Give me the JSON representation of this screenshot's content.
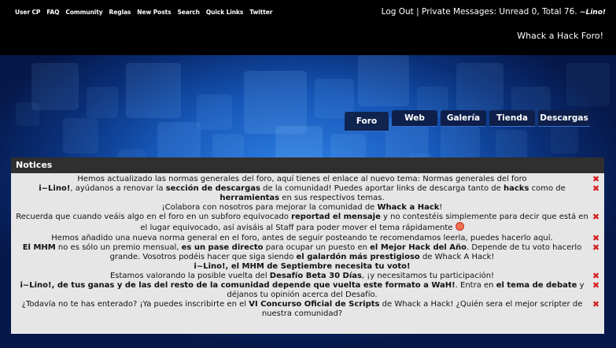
{
  "topnav": [
    "User CP",
    "FAQ",
    "Community",
    "Reglas",
    "New Posts",
    "Search",
    "Quick Links",
    "Twitter"
  ],
  "account": {
    "logout": "Log Out",
    "separator": "|",
    "pm_text": "Private Messages: Unread 0, Total 76.",
    "username": "~Lino!"
  },
  "site_name": "Whack a Hack Foro!",
  "tabs": [
    "Foro",
    "Web",
    "Galería",
    "Tienda",
    "Descargas"
  ],
  "notices": {
    "title": "Notices",
    "close_icon": "close-x-icon",
    "items": [
      {
        "parts": [
          {
            "t": "Hemos actualizado las normas generales del foro, aquí tienes el enlace al nuevo tema: Normas generales del foro"
          }
        ],
        "closable": true
      },
      {
        "parts": [
          {
            "t": "i~Lino!",
            "b": true
          },
          {
            "t": ", ayúdanos a renovar la "
          },
          {
            "t": "sección de descargas",
            "b": true
          },
          {
            "t": " de la comunidad! Puedes aportar links de descarga tanto de "
          },
          {
            "t": "hacks",
            "b": true
          },
          {
            "t": " como de "
          },
          {
            "t": "herramientas",
            "b": true
          },
          {
            "t": " en sus respectivos temas."
          }
        ],
        "closable": true
      },
      {
        "parts": [
          {
            "t": "¡Colabora con nosotros para mejorar la comunidad de "
          },
          {
            "t": "Whack a Hack",
            "b": true
          },
          {
            "t": "!"
          }
        ],
        "closable": false
      },
      {
        "parts": [
          {
            "t": "Recuerda que cuando veáis algo en el foro en un subforo equivocado "
          },
          {
            "t": "reportad el mensaje",
            "b": true
          },
          {
            "t": " y no contestéis simplemente para decir que está en el lugar equivocado, así avisáis al Staff para poder mover el tema rápidamente "
          }
        ],
        "closable": true,
        "smiley": "smiley-icon"
      },
      {
        "parts": [
          {
            "t": "Hemos añadido una nueva norma general en el foro, antes de seguir posteando te recomendamos leerla, puedes hacerlo aquí."
          }
        ],
        "closable": true
      },
      {
        "parts": [
          {
            "t": "El MHM",
            "b": true
          },
          {
            "t": " no es sólo un premio mensual, "
          },
          {
            "t": "es un pase directo",
            "b": true
          },
          {
            "t": " para ocupar un puesto en "
          },
          {
            "t": "el Mejor Hack del Año",
            "b": true
          },
          {
            "t": ". Depende de tu voto hacerlo grande. Vosotros podéis hacer que siga siendo "
          },
          {
            "t": "el galardón más prestigioso",
            "b": true
          },
          {
            "t": " de Whack A Hack!"
          }
        ],
        "closable": true
      },
      {
        "parts": [
          {
            "t": "i~Lino!, el MHM de Septiembre necesita tu voto!",
            "b": true
          }
        ],
        "closable": false
      },
      {
        "parts": [
          {
            "t": "Estamos valorando la posible vuelta del "
          },
          {
            "t": "Desafío Beta 30 Días",
            "b": true
          },
          {
            "t": ", ¡y necesitamos tu participación!"
          }
        ],
        "closable": true
      },
      {
        "parts": [
          {
            "t": "i~Lino!, de tus ganas y de las del resto de la comunidad depende que vuelta este formato a WaH!",
            "b": true
          },
          {
            "t": ". Entra en "
          },
          {
            "t": "el tema de debate",
            "b": true
          },
          {
            "t": " y déjanos tu opinión acerca del Desafío."
          }
        ],
        "closable": true
      },
      {
        "parts": [
          {
            "t": "¿Todavía no te has enterado? ¡Ya puedes inscribirte en el "
          },
          {
            "t": "VI Concurso Oficial de Scripts",
            "b": true
          },
          {
            "t": " de Whack a Hack! ¿Quién sera el mejor scripter de nuestra comunidad?"
          }
        ],
        "closable": true
      }
    ]
  }
}
